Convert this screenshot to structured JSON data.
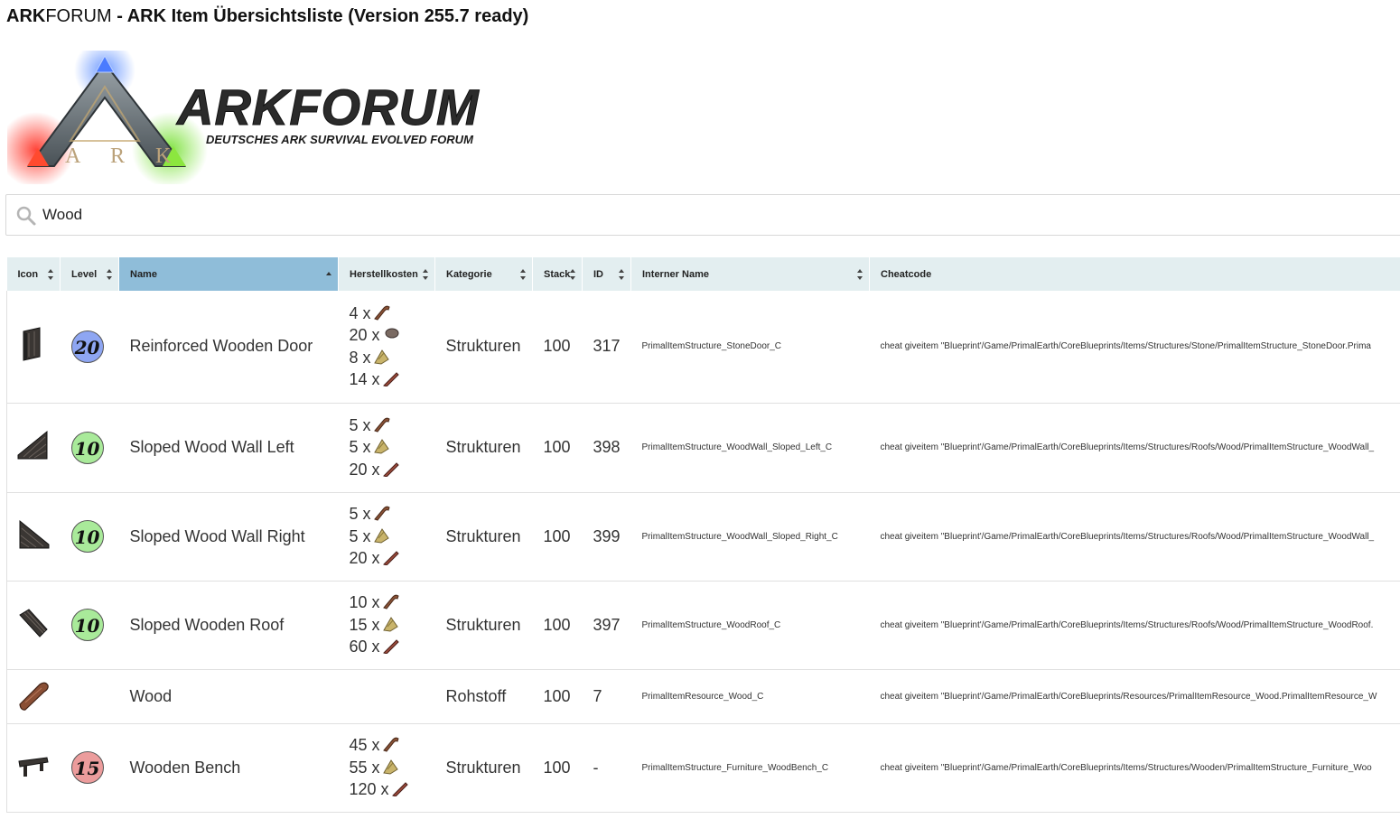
{
  "page": {
    "title_brand": "ARK",
    "title_rest_brand": "FORUM",
    "title_rest": " - ARK Item Übersichtsliste (Version 255.7 ready)"
  },
  "logo": {
    "wordmark": "ARKFORUM",
    "tagline": "DEUTSCHES ARK SURVIVAL EVOLVED FORUM",
    "emblem_text": "A R K",
    "colors": {
      "blue": "#4a7bff",
      "red": "#ff3b2f",
      "green": "#7be13a"
    }
  },
  "search": {
    "value": "Wood",
    "icon": "search-icon"
  },
  "table": {
    "headers": {
      "icon": "Icon",
      "level": "Level",
      "name": "Name",
      "cost": "Herstellkosten",
      "category": "Kategorie",
      "stack": "Stack",
      "id": "ID",
      "internal": "Interner Name",
      "cheat": "Cheatcode"
    },
    "sorted_column": "name",
    "sorted_direction": "ascending",
    "rows": [
      {
        "icon": "reinforced-door-icon",
        "level": "20",
        "level_color": "#8ea6f2",
        "name": "Reinforced Wooden Door",
        "costs": [
          {
            "qty": "4 x",
            "icon": "wood-icon"
          },
          {
            "qty": "20 x",
            "icon": "stone-icon"
          },
          {
            "qty": "8 x",
            "icon": "thatch-icon"
          },
          {
            "qty": "14 x",
            "icon": "fiber-icon"
          }
        ],
        "category": "Strukturen",
        "stack": "100",
        "id": "317",
        "internal": "PrimalItemStructure_StoneDoor_C",
        "cheat": "cheat giveitem \"Blueprint'/Game/PrimalEarth/CoreBlueprints/Items/Structures/Stone/PrimalItemStructure_StoneDoor.Prima"
      },
      {
        "icon": "sloped-wall-left-icon",
        "level": "10",
        "level_color": "#a9ea9a",
        "name": "Sloped Wood Wall Left",
        "costs": [
          {
            "qty": "5 x",
            "icon": "wood-icon"
          },
          {
            "qty": "5 x",
            "icon": "thatch-icon"
          },
          {
            "qty": "20 x",
            "icon": "fiber-icon"
          }
        ],
        "category": "Strukturen",
        "stack": "100",
        "id": "398",
        "internal": "PrimalItemStructure_WoodWall_Sloped_Left_C",
        "cheat": "cheat giveitem \"Blueprint'/Game/PrimalEarth/CoreBlueprints/Items/Structures/Roofs/Wood/PrimalItemStructure_WoodWall_"
      },
      {
        "icon": "sloped-wall-right-icon",
        "level": "10",
        "level_color": "#a9ea9a",
        "name": "Sloped Wood Wall Right",
        "costs": [
          {
            "qty": "5 x",
            "icon": "wood-icon"
          },
          {
            "qty": "5 x",
            "icon": "thatch-icon"
          },
          {
            "qty": "20 x",
            "icon": "fiber-icon"
          }
        ],
        "category": "Strukturen",
        "stack": "100",
        "id": "399",
        "internal": "PrimalItemStructure_WoodWall_Sloped_Right_C",
        "cheat": "cheat giveitem \"Blueprint'/Game/PrimalEarth/CoreBlueprints/Items/Structures/Roofs/Wood/PrimalItemStructure_WoodWall_"
      },
      {
        "icon": "sloped-roof-icon",
        "level": "10",
        "level_color": "#a9ea9a",
        "name": "Sloped Wooden Roof",
        "costs": [
          {
            "qty": "10 x",
            "icon": "wood-icon"
          },
          {
            "qty": "15 x",
            "icon": "thatch-icon"
          },
          {
            "qty": "60 x",
            "icon": "fiber-icon"
          }
        ],
        "category": "Strukturen",
        "stack": "100",
        "id": "397",
        "internal": "PrimalItemStructure_WoodRoof_C",
        "cheat": "cheat giveitem \"Blueprint'/Game/PrimalEarth/CoreBlueprints/Items/Structures/Roofs/Wood/PrimalItemStructure_WoodRoof."
      },
      {
        "icon": "wood-log-icon",
        "level": "",
        "level_color": "",
        "name": "Wood",
        "costs": [],
        "category": "Rohstoff",
        "stack": "100",
        "id": "7",
        "internal": "PrimalItemResource_Wood_C",
        "cheat": "cheat giveitem \"Blueprint'/Game/PrimalEarth/CoreBlueprints/Resources/PrimalItemResource_Wood.PrimalItemResource_W"
      },
      {
        "icon": "bench-icon",
        "level": "15",
        "level_color": "#ec9c9c",
        "name": "Wooden Bench",
        "costs": [
          {
            "qty": "45 x",
            "icon": "wood-icon"
          },
          {
            "qty": "55 x",
            "icon": "thatch-icon"
          },
          {
            "qty": "120 x",
            "icon": "fiber-icon"
          }
        ],
        "category": "Strukturen",
        "stack": "100",
        "id": "-",
        "internal": "PrimalItemStructure_Furniture_WoodBench_C",
        "cheat": "cheat giveitem \"Blueprint'/Game/PrimalEarth/CoreBlueprints/Items/Structures/Wooden/PrimalItemStructure_Furniture_Woo"
      }
    ]
  }
}
